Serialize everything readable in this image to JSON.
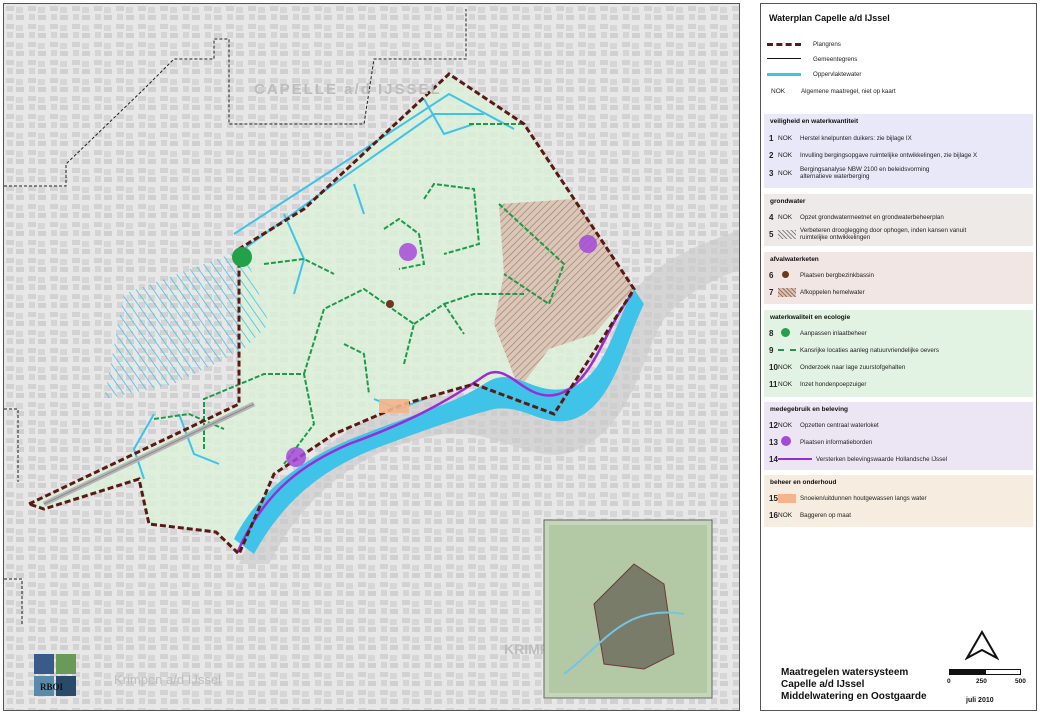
{
  "map": {
    "place_labels": {
      "capelle": "CAPELLE a/d IJSSEL",
      "krimpen": "Krimpen a/d IJssel",
      "krimpen_short": "KRIMP"
    },
    "colors": {
      "plangrens": "#5a1a14",
      "gemeentegrens": "#111111",
      "water": "#3fc3e8",
      "green_dash": "#1f9a4a",
      "purple": "#9b2bd6",
      "background": "#e9e9e9",
      "plan_fill": "#dcf0d9"
    },
    "logo_text": "RBOI"
  },
  "legend": {
    "title": "Waterplan Capelle a/d IJssel",
    "base": [
      {
        "symbol": "plangrens-line",
        "label": "Plangrens"
      },
      {
        "symbol": "gemeentegrens-line",
        "label": "Gemeentegrens"
      },
      {
        "symbol": "water-line",
        "label": "Oppervlaktewater"
      },
      {
        "symbol": "nok-text",
        "nok": "NOK",
        "label": "Algemene maatregel, niet op kaart"
      }
    ],
    "groups": [
      {
        "title": "veiligheid en waterkwantiteit",
        "color": "#e8e8f8",
        "items": [
          {
            "num": "1",
            "nok": "NOK",
            "label": "Herstel knelpunten duikers: zie bijlage IX"
          },
          {
            "num": "2",
            "nok": "NOK",
            "label": "Invulling bergingsopgave ruimtelijke ontwikkelingen, zie bijlage X"
          },
          {
            "num": "3",
            "nok": "NOK",
            "label": "Bergingsanalyse NBW 2100 en beleidsvorming alternatieve waterberging"
          }
        ]
      },
      {
        "title": "grondwater",
        "color": "#eeeae8",
        "items": [
          {
            "num": "4",
            "nok": "NOK",
            "label": "Opzet grondwatermeetnet en grondwaterbeheerplan"
          },
          {
            "num": "5",
            "nok": "",
            "symbol": "hatch-grey",
            "label": "Verbeteren drooglegging door ophogen, inden kansen vanuit ruimtelijke ontwikkelingen"
          }
        ]
      },
      {
        "title": "afvalwaterketen",
        "color": "#f1e6e3",
        "items": [
          {
            "num": "6",
            "nok": "",
            "symbol": "brown-dot",
            "label": "Plaatsen bergbezinkbassin"
          },
          {
            "num": "7",
            "nok": "",
            "symbol": "hatch-brown",
            "label": "Afkoppelen hemelwater"
          }
        ]
      },
      {
        "title": "waterkwaliteit en ecologie",
        "color": "#e3f3e3",
        "items": [
          {
            "num": "8",
            "nok": "",
            "symbol": "green-dot",
            "label": "Aanpassen inlaatbeheer"
          },
          {
            "num": "9",
            "nok": "",
            "symbol": "green-dash",
            "label": "Kansrijke locaties aanleg natuurvriendelijke oevers"
          },
          {
            "num": "10",
            "nok": "NOK",
            "label": "Onderzoek naar lage zuurstofgehalten"
          },
          {
            "num": "11",
            "nok": "NOK",
            "label": "Inzet hondenpoepzuiger"
          }
        ]
      },
      {
        "title": "medegebruik en beleving",
        "color": "#ece6f4",
        "items": [
          {
            "num": "12",
            "nok": "NOK",
            "label": "Opzetten centraal waterloket"
          },
          {
            "num": "13",
            "nok": "",
            "symbol": "purple-dot",
            "label": "Plaatsen informatieborden"
          },
          {
            "num": "14",
            "nok": "",
            "symbol": "purple-line",
            "label": "Versterken belevingswaarde Hollandsche IJssel"
          }
        ]
      },
      {
        "title": "beheer en onderhoud",
        "color": "#f6ece0",
        "items": [
          {
            "num": "15",
            "nok": "",
            "symbol": "orange-rect",
            "label": "Snoeien/uitdunnen houtgewassen langs water"
          },
          {
            "num": "16",
            "nok": "NOK",
            "label": "Baggeren op maat"
          }
        ]
      }
    ],
    "footer": {
      "line1": "Maatregelen watersysteem",
      "line2": "Capelle a/d IJssel",
      "line3": "Middelwatering en Oostgaarde",
      "date": "juli 2010"
    },
    "scale": {
      "labels": [
        "0",
        "250",
        "500"
      ]
    }
  }
}
